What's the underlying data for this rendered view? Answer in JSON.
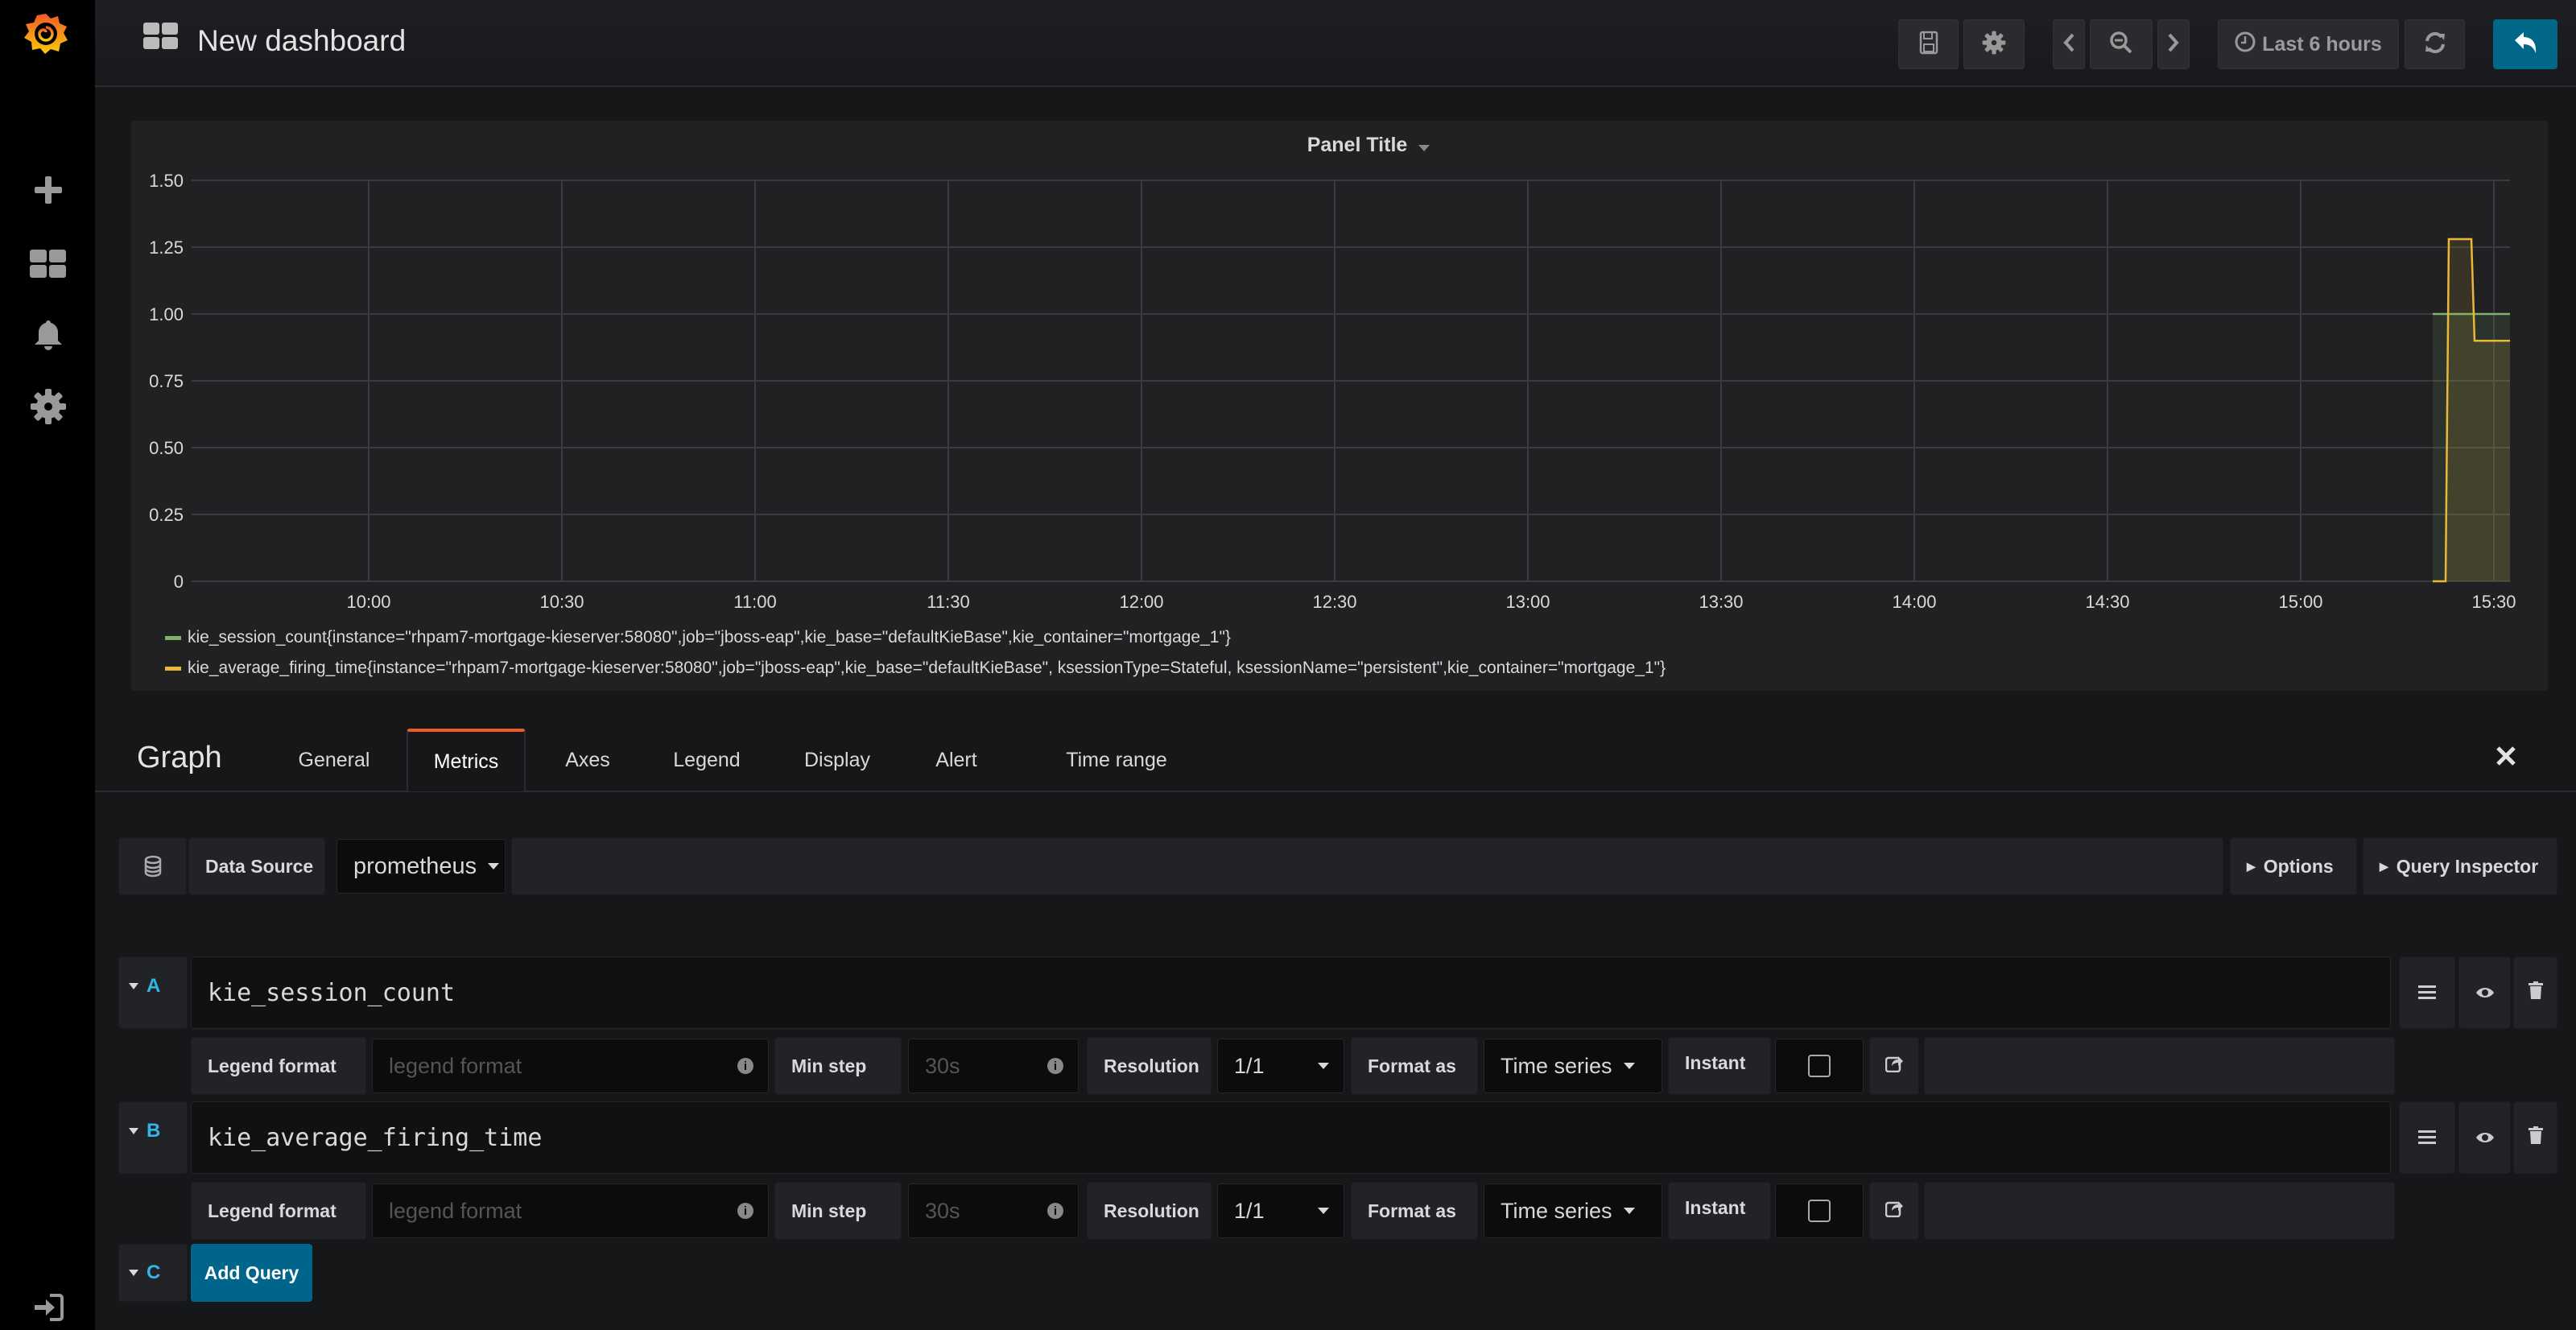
{
  "sidebar": {
    "items": [
      {
        "icon": "plus-icon"
      },
      {
        "icon": "dashboards-icon"
      },
      {
        "icon": "bell-icon"
      },
      {
        "icon": "gear-icon"
      }
    ],
    "bottom_icon": "sign-in-icon",
    "logo_colors": [
      "#f05a28",
      "#fbca0a"
    ]
  },
  "header": {
    "title": "New dashboard",
    "time_range": "Last 6 hours",
    "accent": "#006788"
  },
  "panel": {
    "title": "Panel Title"
  },
  "chart_data": {
    "type": "line",
    "title": "Panel Title",
    "xlim": [
      "09:32:30",
      "15:32:30"
    ],
    "ylim": [
      0,
      1.5
    ],
    "x_ticks": [
      "10:00",
      "10:30",
      "11:00",
      "11:30",
      "12:00",
      "12:30",
      "13:00",
      "13:30",
      "14:00",
      "14:30",
      "15:00",
      "15:30"
    ],
    "y_ticks": [
      "0",
      "0.25",
      "0.50",
      "0.75",
      "1.00",
      "1.25",
      "1.50"
    ],
    "y_tick_values": [
      0,
      0.25,
      0.5,
      0.75,
      1,
      1.25,
      1.5
    ],
    "grid": true,
    "fill": true,
    "legend_placement": "bottom",
    "series": [
      {
        "name": "kie_session_count{instance=\"rhpam7-mortgage-kieserver:58080\",job=\"jboss-eap\",kie_base=\"defaultKieBase\",kie_container=\"mortgage_1\"}",
        "color": "#7eb26d",
        "points": [
          [
            "15:20:30",
            1
          ],
          [
            "15:32:30",
            1
          ]
        ]
      },
      {
        "name": "kie_average_firing_time{instance=\"rhpam7-mortgage-kieserver:58080\",job=\"jboss-eap\",kie_base=\"defaultKieBase\", ksessionType=Stateful, ksessionName=\"persistent\",kie_container=\"mortgage_1\"}",
        "color": "#eab839",
        "points": [
          [
            "15:20:30",
            0
          ],
          [
            "15:22:30",
            0
          ],
          [
            "15:23:00",
            1.28
          ],
          [
            "15:26:30",
            1.28
          ],
          [
            "15:27:00",
            0.9
          ],
          [
            "15:32:30",
            0.9
          ]
        ]
      }
    ]
  },
  "editor": {
    "panel_type": "Graph",
    "tabs": [
      "General",
      "Metrics",
      "Axes",
      "Legend",
      "Display",
      "Alert",
      "Time range"
    ],
    "active_tab": "Metrics",
    "data_source_label": "Data Source",
    "data_source": "prometheus",
    "options_label": "Options",
    "query_inspector_label": "Query Inspector",
    "queries": [
      {
        "letter": "A",
        "expr": "kie_session_count",
        "legend_label": "Legend format",
        "legend_placeholder": "legend format",
        "min_step_label": "Min step",
        "min_step_placeholder": "30s",
        "resolution_label": "Resolution",
        "resolution": "1/1",
        "format_label": "Format as",
        "format": "Time series",
        "instant_label": "Instant",
        "instant": false
      },
      {
        "letter": "B",
        "expr": "kie_average_firing_time",
        "legend_label": "Legend format",
        "legend_placeholder": "legend format",
        "min_step_label": "Min step",
        "min_step_placeholder": "30s",
        "resolution_label": "Resolution",
        "resolution": "1/1",
        "format_label": "Format as",
        "format": "Time series",
        "instant_label": "Instant",
        "instant": false
      }
    ],
    "next_letter": "C",
    "add_query_label": "Add Query"
  }
}
